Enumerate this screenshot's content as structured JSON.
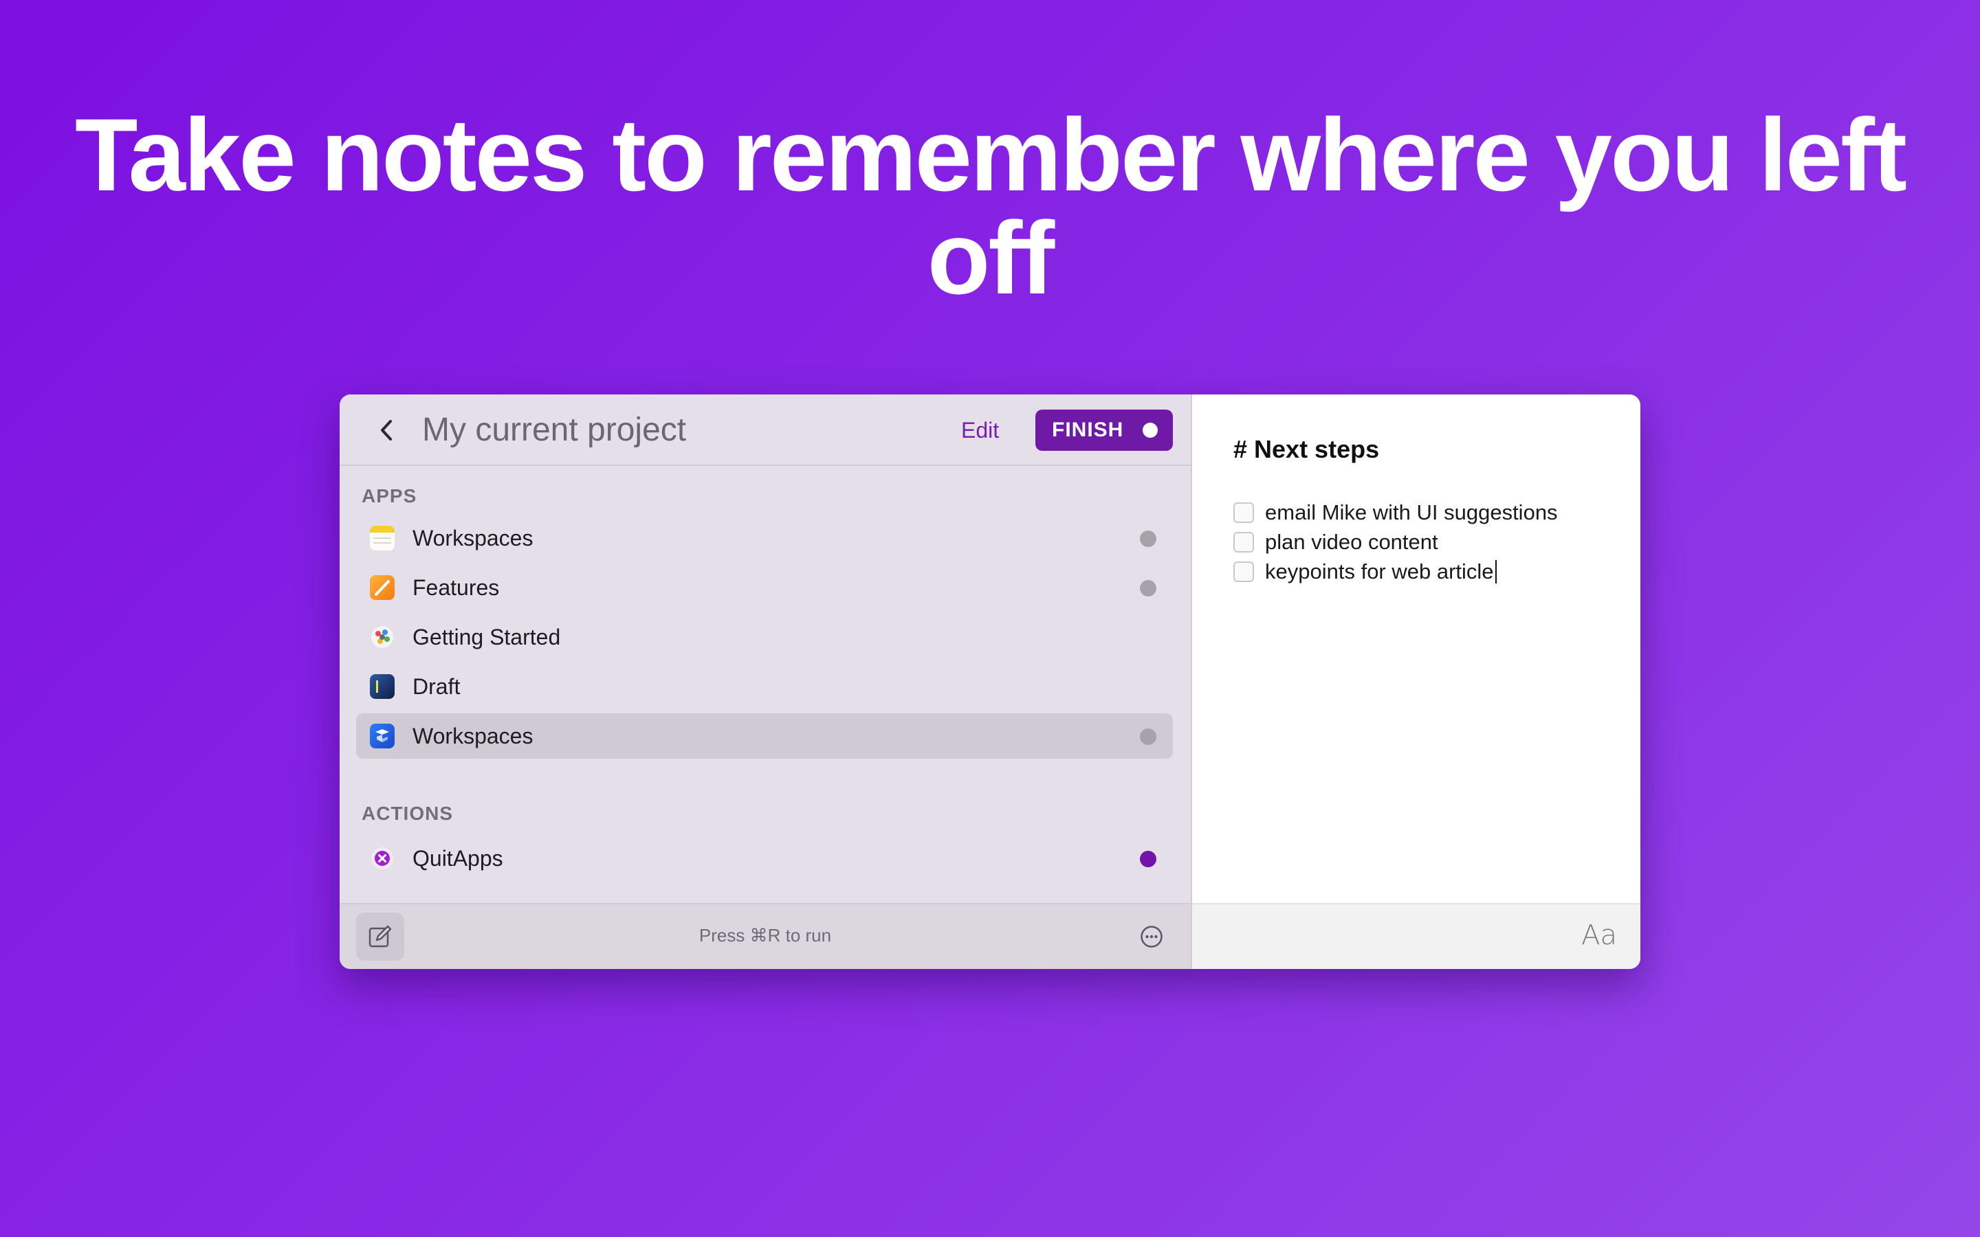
{
  "headline": "Take notes to remember where you left off",
  "window": {
    "title": "My current project",
    "edit_label": "Edit",
    "finish_label": "FINISH"
  },
  "apps_section": {
    "header": "APPS",
    "items": [
      {
        "label": "Workspaces",
        "icon": "notes-app-icon",
        "has_dot": true
      },
      {
        "label": "Features",
        "icon": "pages-app-icon",
        "has_dot": true
      },
      {
        "label": "Getting Started",
        "icon": "launchpad-app-icon",
        "has_dot": false
      },
      {
        "label": "Draft",
        "icon": "draft-app-icon",
        "has_dot": false
      },
      {
        "label": "Workspaces",
        "icon": "workspaces-app-icon",
        "has_dot": true,
        "selected": true
      }
    ]
  },
  "actions_section": {
    "header": "ACTIONS",
    "items": [
      {
        "label": "QuitApps",
        "icon": "quitapps-icon",
        "dot_color": "#7214a8"
      }
    ]
  },
  "bottom_bar": {
    "hint": "Press ⌘R to run"
  },
  "notes": {
    "heading": "# Next steps",
    "todos": [
      {
        "text": "email Mike with UI suggestions",
        "checked": false
      },
      {
        "text": "plan video content",
        "checked": false
      },
      {
        "text": "keypoints for web article",
        "checked": false
      }
    ],
    "font_button": "Aa"
  },
  "colors": {
    "background_start": "#7c10e0",
    "background_end": "#9446e9",
    "accent": "#6e1aa6"
  }
}
